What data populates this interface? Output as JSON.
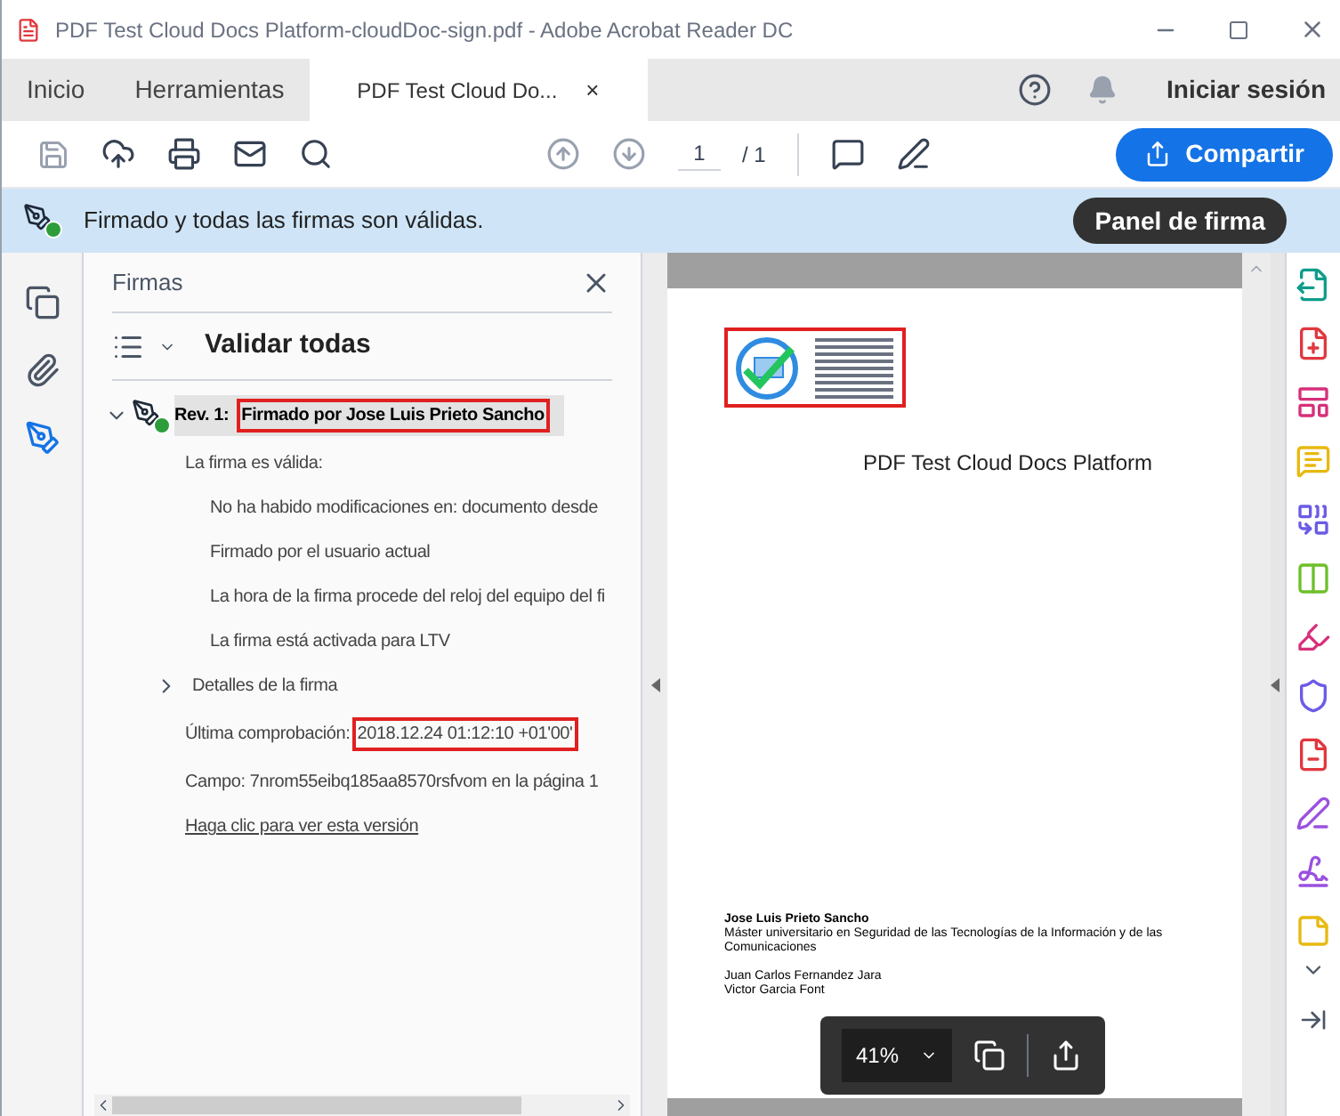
{
  "window": {
    "title": "PDF Test Cloud Docs Platform-cloudDoc-sign.pdf - Adobe Acrobat Reader DC"
  },
  "tabs": [
    {
      "label": "Inicio",
      "selected": false
    },
    {
      "label": "Herramientas",
      "selected": false
    },
    {
      "label": "PDF Test Cloud Do...",
      "selected": true,
      "close": "×"
    }
  ],
  "sign_in": "Iniciar sesión",
  "toolbar": {
    "page_current": "1",
    "page_total": "/ 1",
    "share": "Compartir"
  },
  "notification": {
    "text": "Firmado y todas las firmas son válidas.",
    "button": "Panel de firma"
  },
  "left_rail": [
    {
      "selected": false
    },
    {
      "selected": false
    },
    {
      "selected": true
    }
  ],
  "panel": {
    "title": "Firmas",
    "validate": "Validar todas",
    "signature": {
      "expanded": true,
      "revision": "Rev. 1:",
      "signer": "Firmado por Jose Luis Prieto Sancho",
      "status": "La firma es válida:",
      "details": [
        "No ha habido modificaciones en: documento desde",
        "Firmado por el usuario actual",
        "La hora de la firma procede del reloj del equipo del fi",
        "La firma está activada para LTV"
      ],
      "details_toggle": {
        "label": "Detalles de la firma",
        "expanded": false
      },
      "last_check_label": "Última comprobación:",
      "last_check_value": "2018.12.24 01:12:10 +01'00'",
      "field": "Campo: 7nrom55eibq185aa8570rsfvom en la página 1",
      "link": "Haga clic para ver esta versión"
    }
  },
  "document": {
    "heading": "PDF Test Cloud Docs Platform",
    "author_blocks": [
      [
        "Jose Luis Prieto Sancho",
        "Máster universitario en Seguridad de las Tecnologías de la Información y de las Comunicaciones"
      ],
      [
        "Juan Carlos Fernandez Jara",
        "Victor Garcia Font"
      ]
    ],
    "zoom": "41%"
  },
  "right_rail": [
    {
      "color": "#0f9d8a"
    },
    {
      "color": "#e0383e"
    },
    {
      "color": "#d6307a"
    },
    {
      "color": "#e8b90f"
    },
    {
      "color": "#6b5be6"
    },
    {
      "color": "#6fbf2a"
    },
    {
      "color": "#d6307a"
    },
    {
      "color": "#6b5be6"
    },
    {
      "color": "#e0383e"
    },
    {
      "color": "#9b51e0"
    },
    {
      "color": "#9b51e0"
    },
    {
      "color": "#e8b90f"
    }
  ]
}
